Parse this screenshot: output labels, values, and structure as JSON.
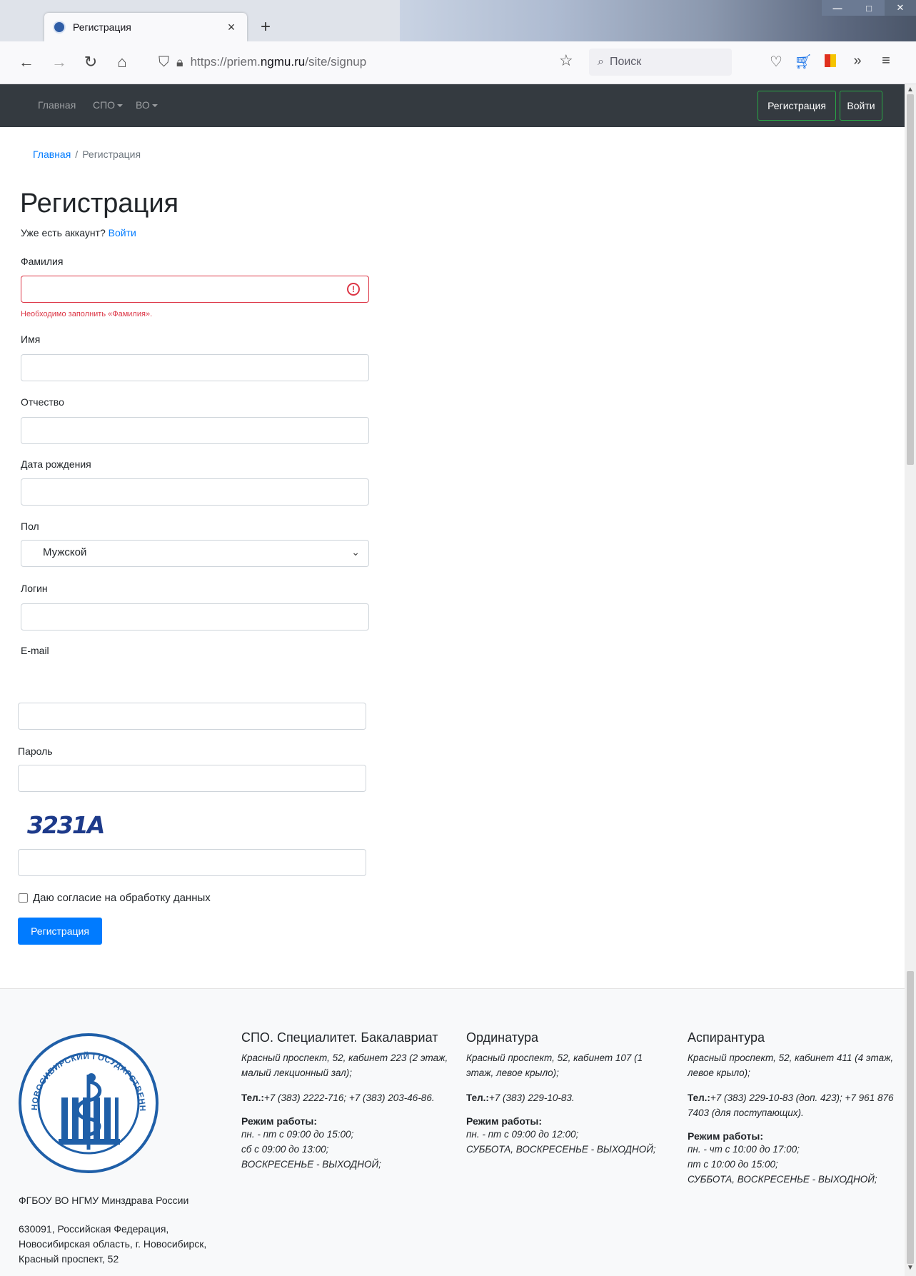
{
  "browser": {
    "tab_title": "Регистрация",
    "url_prefix": "https://priem.",
    "url_domain": "ngmu.ru",
    "url_path": "/site/signup",
    "search_placeholder": "Поиск"
  },
  "navbar": {
    "items": [
      {
        "label": "Главная"
      },
      {
        "label": "СПО"
      },
      {
        "label": "ВО"
      }
    ],
    "register_label": "Регистрация",
    "login_label": "Войти"
  },
  "breadcrumb": {
    "home": "Главная",
    "separator": "/",
    "current": "Регистрация"
  },
  "page": {
    "title": "Регистрация",
    "has_account_text": "Уже есть аккаунт?",
    "login_link": "Войти"
  },
  "form": {
    "surname_label": "Фамилия",
    "surname_value": "",
    "surname_error": "Необходимо заполнить «Фамилия».",
    "name_label": "Имя",
    "name_value": "",
    "patronymic_label": "Отчество",
    "patronymic_value": "",
    "birthdate_label": "Дата рождения",
    "birthdate_value": "",
    "gender_label": "Пол",
    "gender_value": "Мужской",
    "login_label": "Логин",
    "login_value": "",
    "email_label": "E-mail",
    "email_value": "",
    "password_label": "Пароль",
    "password_value": "",
    "captcha_text": "3231A",
    "captcha_value": "",
    "consent_label": "Даю согласие на обработку данных",
    "consent_checked": false,
    "submit_label": "Регистрация"
  },
  "footer": {
    "org": "ФГБОУ ВО НГМУ Минздрава России",
    "address": "630091, Российская Федерация, Новосибирская область, г. Новосибирск, Красный проспект, 52",
    "logo_text": "НОВОСИБИРСКИЙ ГОСУДАРСТВЕННЫЙ МЕДИЦИНСКИЙ УНИВЕРСИТЕТ",
    "columns": [
      {
        "title": "СПО. Специалитет. Бакалавриат",
        "address": "Красный проспект, 52, кабинет 223 (2 этаж, малый лекционный зал);",
        "phone_label": "Тел.:",
        "phone": "+7 (383) 2222-716; +7 (383) 203-46-86.",
        "hours_title": "Режим работы:",
        "hours": [
          "пн. - пт с 09:00 до 15:00;",
          "сб с 09:00 до 13:00;",
          "ВОСКРЕСЕНЬЕ - ВЫХОДНОЙ;"
        ]
      },
      {
        "title": "Ординатура",
        "address": "Красный проспект, 52, кабинет 107 (1 этаж, левое крыло);",
        "phone_label": "Тел.:",
        "phone": "+7 (383) 229-10-83.",
        "hours_title": "Режим работы:",
        "hours": [
          "пн. - пт с 09:00 до 12:00;",
          "СУББОТА, ВОСКРЕСЕНЬЕ - ВЫХОДНОЙ;"
        ]
      },
      {
        "title": "Аспирантура",
        "address": "Красный проспект, 52, кабинет 411 (4 этаж, левое крыло);",
        "phone_label": "Тел.:",
        "phone": "+7 (383) 229-10-83 (доп. 423); +7 961 876 7403 (для поступающих).",
        "hours_title": "Режим работы:",
        "hours": [
          "пн. - чт с 10:00 до 17:00;",
          "пт с 10:00 до 15:00;",
          "СУББОТА, ВОСКРЕСЕНЬЕ - ВЫХОДНОЙ;"
        ]
      }
    ]
  },
  "colors": {
    "navbar_bg": "#343a40",
    "link": "#007bff",
    "error": "#dc3545",
    "primary": "#007bff",
    "outline_success": "#28a745",
    "logo_blue": "#1f5fa8"
  }
}
